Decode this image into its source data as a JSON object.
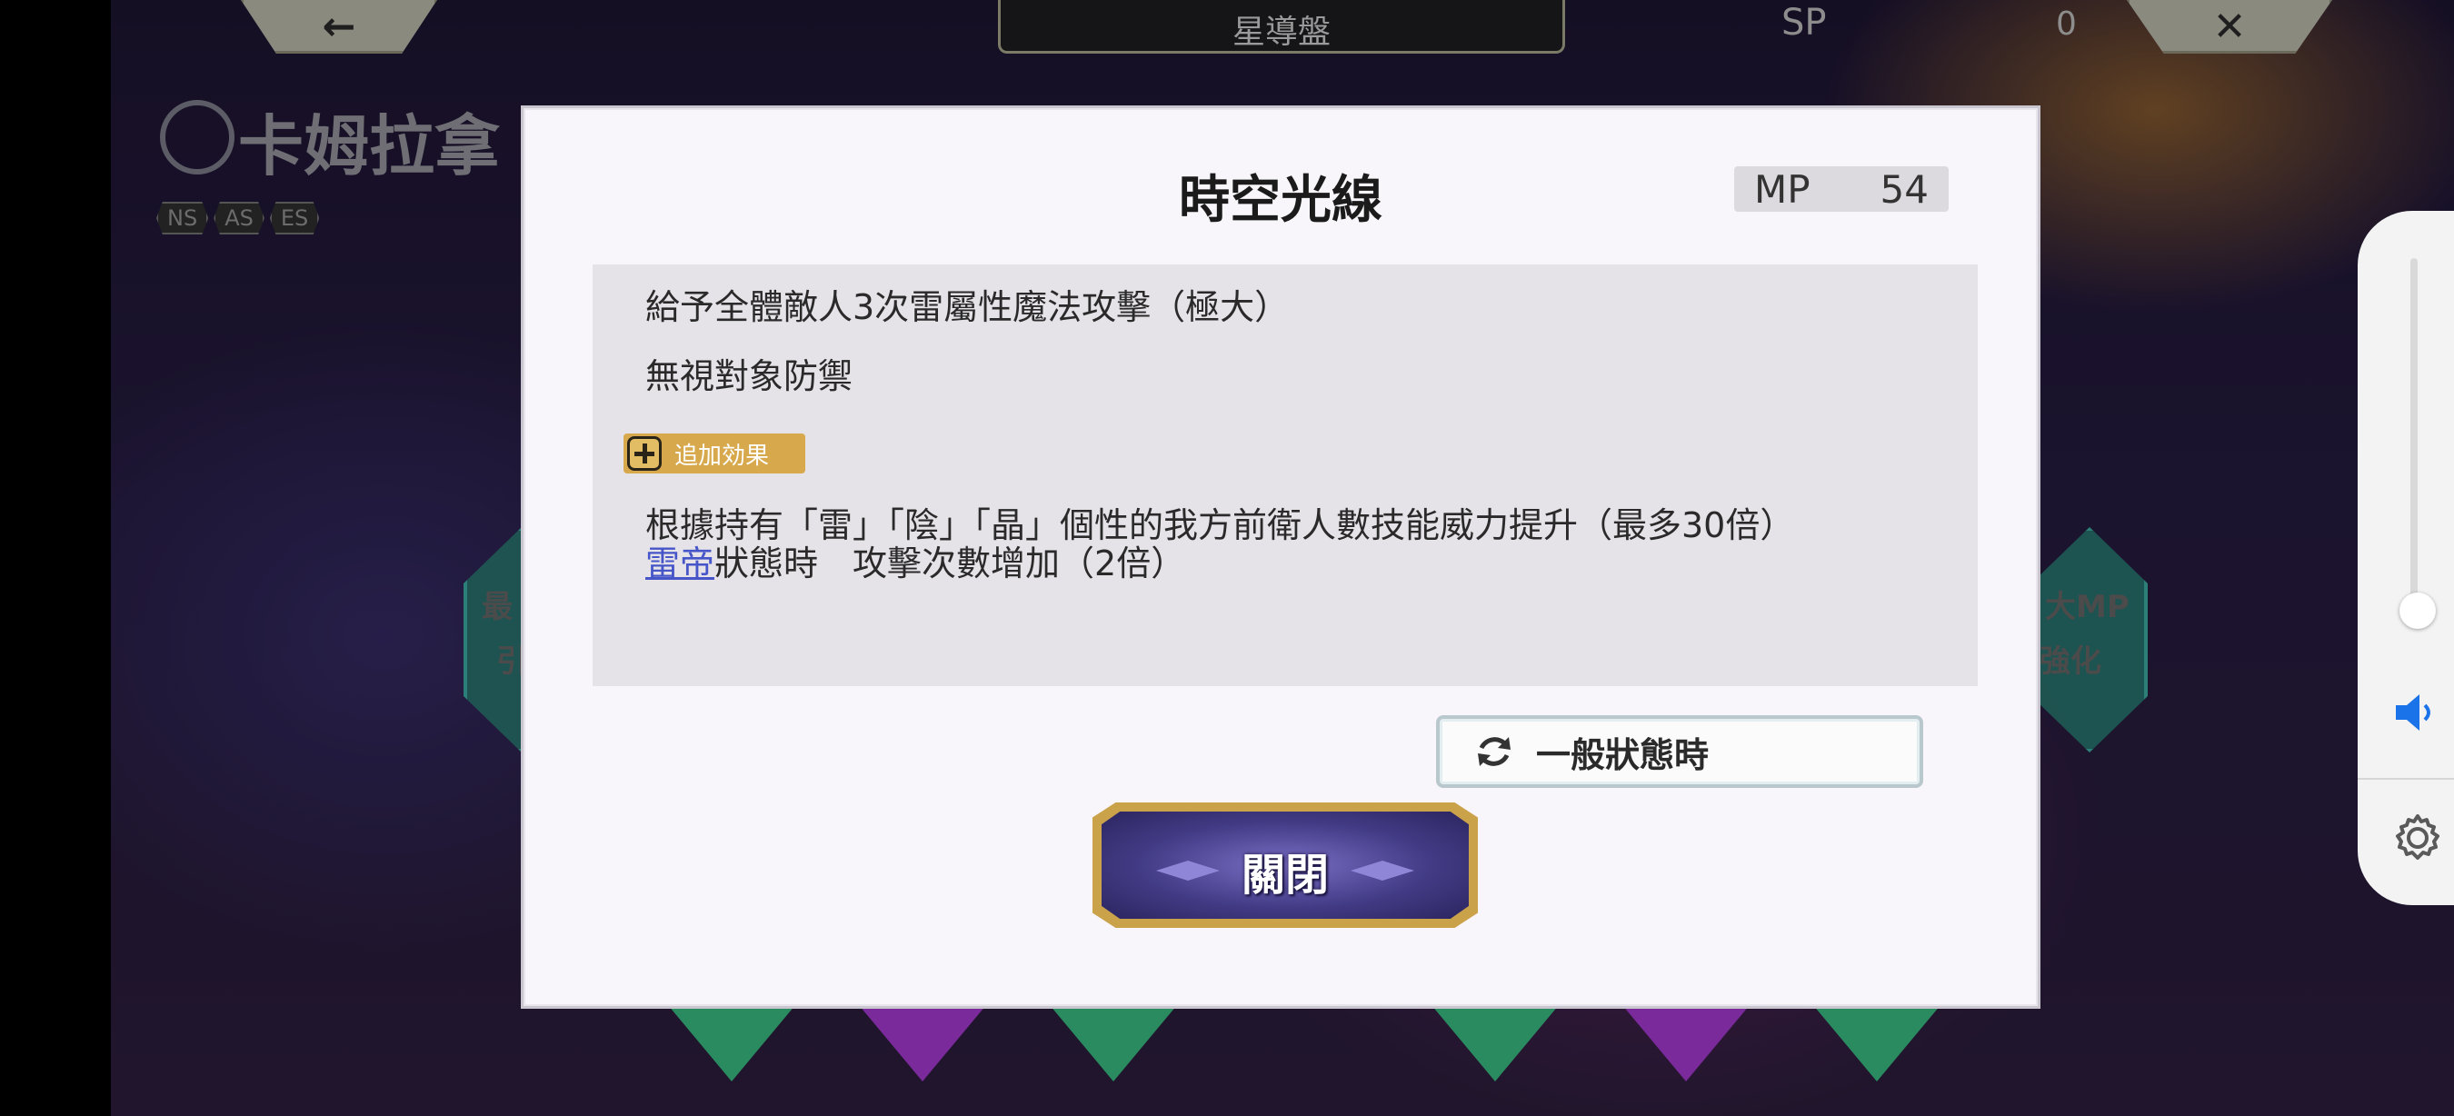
{
  "background": {
    "title_tab": "星導盤",
    "sp_label": "SP",
    "sp_value": "0",
    "character_name": "卡姆拉拿",
    "tags": [
      "NS",
      "AS",
      "ES"
    ],
    "left_hex_text": [
      "最",
      "引"
    ],
    "right_hex_text": [
      "大MP",
      "強化"
    ],
    "back_icon": "arrow-left-icon",
    "close_icon": "close-x-icon"
  },
  "dialog": {
    "title": "時空光線",
    "mp_label": "MP",
    "mp_value": "54",
    "description": {
      "line1": "給予全體敵人3次雷屬性魔法攻擊（極大）",
      "line2": "無視對象防禦",
      "extra_badge": "追加効果",
      "line3": "根據持有「雷」「陰」「晶」個性的我方前衛人數技能威力提升（最多30倍）",
      "line4_link": "雷帝",
      "line4_rest": "狀態時　攻擊次數增加（2倍）"
    },
    "state_button": "一般狀態時",
    "close_button": "關閉"
  },
  "system_panel": {
    "volume_level": 0.1,
    "speaker_icon": "speaker-icon",
    "settings_icon": "gear-icon"
  },
  "colors": {
    "link": "#4655c8",
    "badge": "#d7a94c",
    "close_button_fill": "#433c86"
  }
}
